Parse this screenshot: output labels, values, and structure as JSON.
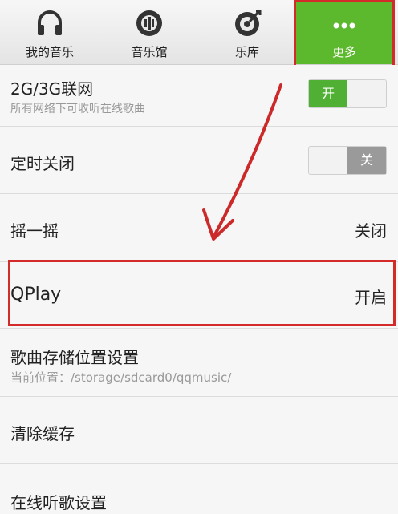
{
  "tabs": [
    {
      "label": "我的音乐",
      "icon": "headphones-icon"
    },
    {
      "label": "音乐馆",
      "icon": "music-hall-icon"
    },
    {
      "label": "乐库",
      "icon": "library-icon"
    },
    {
      "label": "更多",
      "icon": "more-dots-icon",
      "active": true
    }
  ],
  "settings": {
    "network": {
      "title": "2G/3G联网",
      "subtitle": "所有网络下可收听在线歌曲",
      "toggle": "开",
      "state": "on"
    },
    "timer": {
      "title": "定时关闭",
      "toggle": "关",
      "state": "off"
    },
    "shake": {
      "title": "摇一摇",
      "value": "关闭"
    },
    "qplay": {
      "title": "QPlay",
      "value": "开启"
    },
    "storage": {
      "title": "歌曲存储位置设置",
      "subtitle": "当前位置：/storage/sdcard0/qqmusic/"
    },
    "cache": {
      "title": "清除缓存"
    },
    "online": {
      "title": "在线听歌设置"
    }
  },
  "colors": {
    "accent": "#5cb82c",
    "highlight": "#d32a2a"
  }
}
